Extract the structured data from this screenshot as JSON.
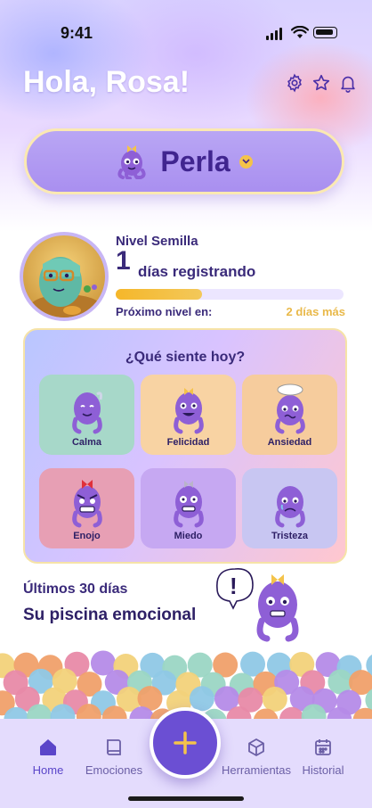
{
  "status_bar": {
    "time": "9:41"
  },
  "header": {
    "greeting": "Hola, Rosa!",
    "icons": [
      "gear-icon",
      "star-icon",
      "bell-icon"
    ]
  },
  "pet_selector": {
    "name": "Perla",
    "icon": "chevron-down-icon"
  },
  "level": {
    "title": "Nivel Semilla",
    "days_count": "1",
    "days_label": "días registrando",
    "progress": 0.38,
    "next_label": "Próximo nivel en:",
    "next_value": "2 días más"
  },
  "emotions": {
    "title": "¿Qué siente hoy?",
    "items": [
      {
        "label": "Calma",
        "color": "#a7d8c9"
      },
      {
        "label": "Felicidad",
        "color": "#f8d3a3"
      },
      {
        "label": "Ansiedad",
        "color": "#f6cc9d"
      },
      {
        "label": "Enojo",
        "color": "#e79fb4"
      },
      {
        "label": "Miedo",
        "color": "#c6a8f2"
      },
      {
        "label": "Tristeza",
        "color": "#c8c6f2"
      }
    ]
  },
  "pool": {
    "period": "Últimos 30 días",
    "title": "Su piscina emocional"
  },
  "nav": {
    "items": [
      {
        "label": "Home",
        "icon": "home-icon",
        "active": true
      },
      {
        "label": "Emociones",
        "icon": "book-icon",
        "active": false
      },
      {
        "label": "Herramientas",
        "icon": "cube-icon",
        "active": false
      },
      {
        "label": "Historial",
        "icon": "calendar-icon",
        "active": false
      }
    ],
    "fab_icon": "plus-icon"
  },
  "colors": {
    "accent": "#6b4fd3",
    "brand_dark": "#3a2a7a",
    "progress": "#f5b72a"
  }
}
